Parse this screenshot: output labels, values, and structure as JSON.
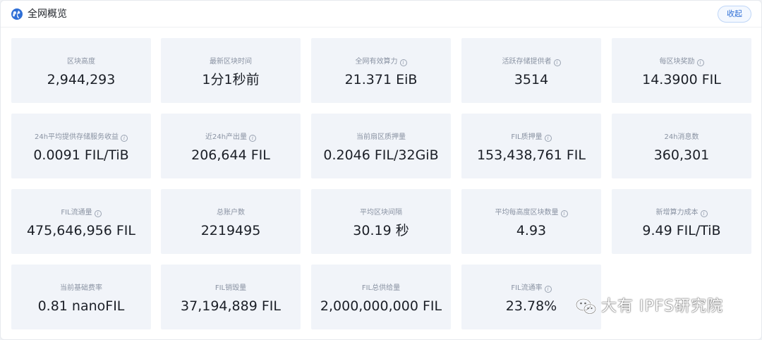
{
  "header": {
    "title": "全网概览",
    "collapse_label": "收起"
  },
  "cards": [
    {
      "label": "区块高度",
      "value": "2,944,293",
      "info": false
    },
    {
      "label": "最新区块时间",
      "value": "1分1秒前",
      "info": false
    },
    {
      "label": "全网有效算力",
      "value": "21.371 EiB",
      "info": true
    },
    {
      "label": "活跃存储提供者",
      "value": "3514",
      "info": true
    },
    {
      "label": "每区块奖励",
      "value": "14.3900 FIL",
      "info": true
    },
    {
      "label": "24h平均提供存储服务收益",
      "value": "0.0091 FIL/TiB",
      "info": true
    },
    {
      "label": "近24h产出量",
      "value": "206,644 FIL",
      "info": true
    },
    {
      "label": "当前扇区质押量",
      "value": "0.2046 FIL/32GiB",
      "info": false
    },
    {
      "label": "FIL质押量",
      "value": "153,438,761 FIL",
      "info": true
    },
    {
      "label": "24h消息数",
      "value": "360,301",
      "info": false
    },
    {
      "label": "FIL流通量",
      "value": "475,646,956 FIL",
      "info": true
    },
    {
      "label": "总账户数",
      "value": "2219495",
      "info": false
    },
    {
      "label": "平均区块间隔",
      "value": "30.19 秒",
      "info": false
    },
    {
      "label": "平均每高度区块数量",
      "value": "4.93",
      "info": true
    },
    {
      "label": "新增算力成本",
      "value": "9.49 FIL/TiB",
      "info": true
    },
    {
      "label": "当前基础费率",
      "value": "0.81 nanoFIL",
      "info": false
    },
    {
      "label": "FIL销毁量",
      "value": "37,194,889 FIL",
      "info": false
    },
    {
      "label": "FIL总供给量",
      "value": "2,000,000,000 FIL",
      "info": false
    },
    {
      "label": "FIL流通率",
      "value": "23.78%",
      "info": true
    }
  ],
  "watermark": {
    "text": "大有 IPFS研究院"
  },
  "colors": {
    "card_bg": "#f1f4f9",
    "accent": "#2f6fd6",
    "label": "#8a93a3",
    "value": "#1b1f27"
  }
}
